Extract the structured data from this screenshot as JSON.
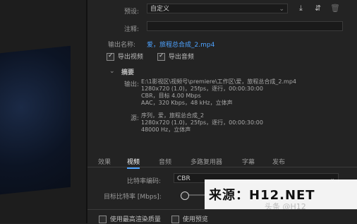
{
  "export": {
    "preset_label": "预设:",
    "preset_value": "自定义",
    "comment_label": "注释:",
    "output_name_label": "输出名称:",
    "output_name_value": "爱，旅程总合成_2.mp4",
    "export_video_label": "导出视频",
    "export_audio_label": "导出音频",
    "export_video_checked": true,
    "export_audio_checked": true
  },
  "summary": {
    "title": "摘要",
    "output_label": "输出:",
    "output_path": "E:\\1影视区\\视频号\\premiere\\工作区\\爱，旅程总合成_2.mp4",
    "output_line2": "1280x720 (1.0)，25fps，逐行，00:00:30:00",
    "output_line3": "CBR，目标 4.00 Mbps",
    "output_line4": "AAC，320 Kbps，48 kHz，立体声",
    "source_label": "源:",
    "source_line1": "序列，爱，旅程总合成_2",
    "source_line2": "1280x720 (1.0)，25fps，逐行，00:00:30:00",
    "source_line3": "48000 Hz，立体声"
  },
  "tabs": [
    {
      "label": "效果"
    },
    {
      "label": "视频"
    },
    {
      "label": "音频"
    },
    {
      "label": "多路复用器"
    },
    {
      "label": "字幕"
    },
    {
      "label": "发布"
    }
  ],
  "bitrate": {
    "encoding_label": "比特率编码:",
    "encoding_value": "CBR",
    "target_label": "目标比特率 [Mbps]:"
  },
  "bottom": {
    "max_render_quality": "使用最高渲染质量",
    "use_preview": "使用预览"
  },
  "watermark": {
    "text": "来源：H12.NET",
    "sub": "头条 @H12"
  },
  "colors": {
    "accent": "#4ea3ff",
    "panel_bg": "#232323"
  }
}
